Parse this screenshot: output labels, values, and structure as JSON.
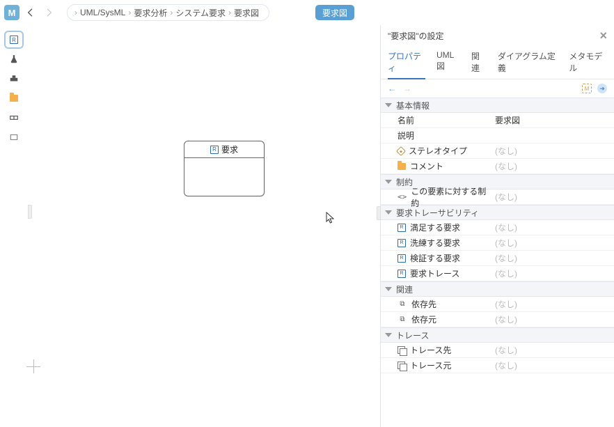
{
  "header": {
    "logo": "M",
    "breadcrumb": [
      "UML/SysML",
      "要求分析",
      "システム要求",
      "要求図"
    ],
    "badge_label": "要求図"
  },
  "canvas_block": {
    "title": "要求"
  },
  "panel": {
    "title": "\"要求図\"の設定",
    "tabs": [
      "プロパティ",
      "UML図",
      "関連",
      "ダイアグラム定義",
      "メタモデル"
    ],
    "active_tab": 0,
    "none_label": "(なし)",
    "sections": [
      {
        "name": "基本情報",
        "rows": [
          {
            "icon": "",
            "label": "名前",
            "value": "要求図"
          },
          {
            "icon": "",
            "label": "説明",
            "value": ""
          },
          {
            "icon": "tag",
            "label": "ステレオタイプ",
            "value": null
          },
          {
            "icon": "folder",
            "label": "コメント",
            "value": null
          }
        ]
      },
      {
        "name": "制約",
        "rows": [
          {
            "icon": "angle",
            "label": "この要素に対する制約",
            "value": null
          }
        ]
      },
      {
        "name": "要求トレーサビリティ",
        "rows": [
          {
            "icon": "rbox",
            "label": "満足する要求",
            "value": null
          },
          {
            "icon": "rbox",
            "label": "洗練する要求",
            "value": null
          },
          {
            "icon": "rbox",
            "label": "検証する要求",
            "value": null
          },
          {
            "icon": "rbox",
            "label": "要求トレース",
            "value": null
          }
        ]
      },
      {
        "name": "関連",
        "rows": [
          {
            "icon": "link",
            "label": "依存先",
            "value": null
          },
          {
            "icon": "link",
            "label": "依存元",
            "value": null
          }
        ]
      },
      {
        "name": "トレース",
        "rows": [
          {
            "icon": "stack",
            "label": "トレース先",
            "value": null
          },
          {
            "icon": "stack",
            "label": "トレース元",
            "value": null
          }
        ]
      }
    ]
  }
}
